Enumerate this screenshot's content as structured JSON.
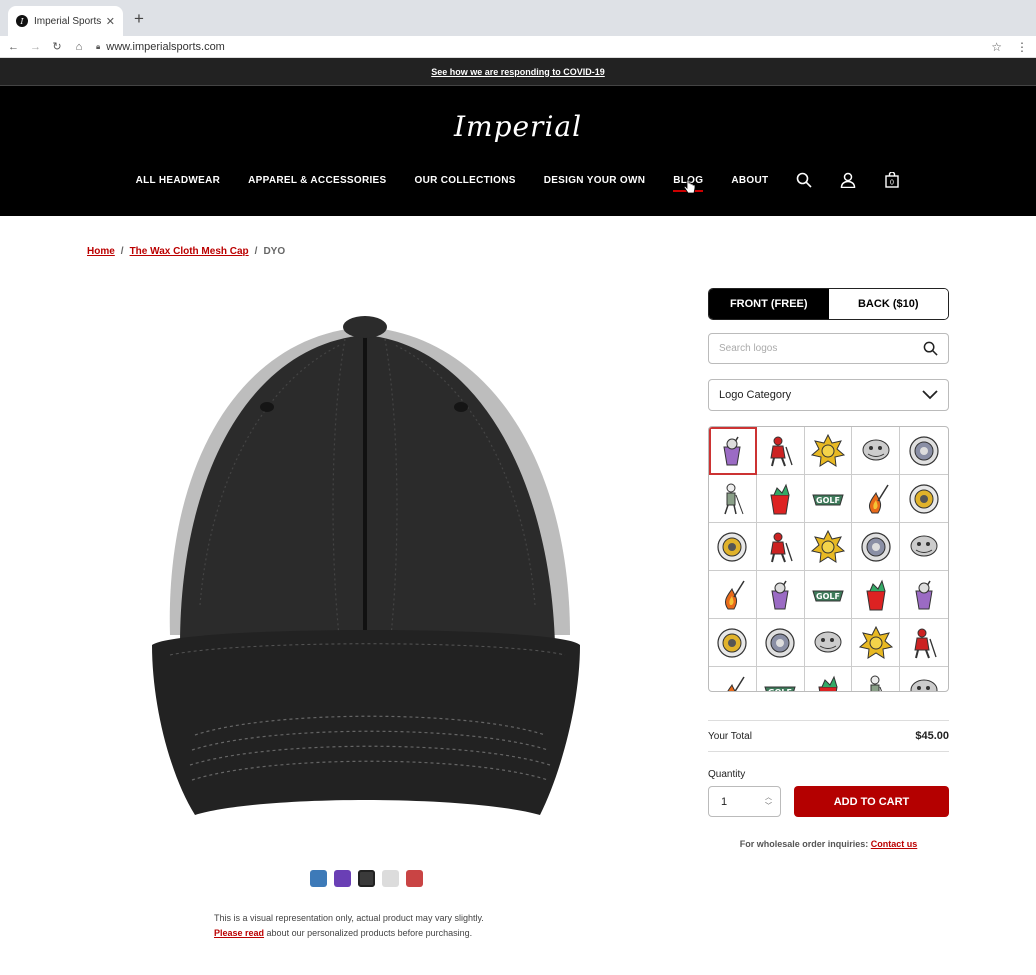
{
  "browser": {
    "tab_title": "Imperial Sports",
    "url": "www.imperialsports.com"
  },
  "banner": {
    "text": "See how we are responding to COVID-19"
  },
  "header": {
    "logo": "Imperial",
    "nav": [
      "ALL HEADWEAR",
      "APPAREL & ACCESSORIES",
      "OUR COLLECTIONS",
      "DESIGN YOUR OWN",
      "BLOG",
      "ABOUT"
    ],
    "cart_count": "0"
  },
  "breadcrumb": {
    "home": "Home",
    "product": "The Wax Cloth Mesh Cap",
    "current": "DYO",
    "separator": "/"
  },
  "product": {
    "swatches": [
      {
        "color": "#3d7ab8",
        "selected": false
      },
      {
        "color": "#6a3fb5",
        "selected": false
      },
      {
        "color": "#3a3a3a",
        "selected": true
      },
      {
        "color": "#dcdcdc",
        "selected": false
      },
      {
        "color": "#c94444",
        "selected": false
      }
    ],
    "disclaimer_line1": "This is a visual representation only, actual product may vary slightly.",
    "disclaimer_link": "Please read",
    "disclaimer_line2": " about our personalized products before purchasing."
  },
  "panel": {
    "front_label": "FRONT (FREE)",
    "back_label": "BACK ($10)",
    "search_placeholder": "Search logos",
    "category_label": "Logo Category",
    "total_label": "Your Total",
    "total_value": "$45.00",
    "quantity_label": "Quantity",
    "quantity_value": "1",
    "add_to_cart": "ADD TO CART",
    "wholesale_text": "For wholesale order inquiries: ",
    "wholesale_link": "Contact us"
  },
  "logo_grid": {
    "icons": [
      "purple-cup-icon",
      "red-golfer-icon",
      "yellow-sun-icon",
      "gray-creature-icon",
      "gray-seal-icon",
      "skeleton-golfer-icon",
      "red-cup-icon",
      "golf-wordmark-icon",
      "flame-club-icon",
      "yellow-seal-icon",
      "yellow-seal-icon",
      "red-golfer-icon",
      "yellow-sun-icon",
      "gray-seal-icon",
      "gray-creature-icon",
      "flame-club-icon",
      "purple-cup-icon",
      "golf-wordmark-icon",
      "red-cup-icon",
      "purple-cup-icon",
      "yellow-seal-icon",
      "gray-seal-icon",
      "gray-creature-icon",
      "yellow-sun-icon",
      "red-golfer-icon",
      "flame-club-icon",
      "golf-wordmark-icon",
      "red-cup-icon",
      "skeleton-golfer-icon",
      "gray-creature-icon"
    ]
  }
}
